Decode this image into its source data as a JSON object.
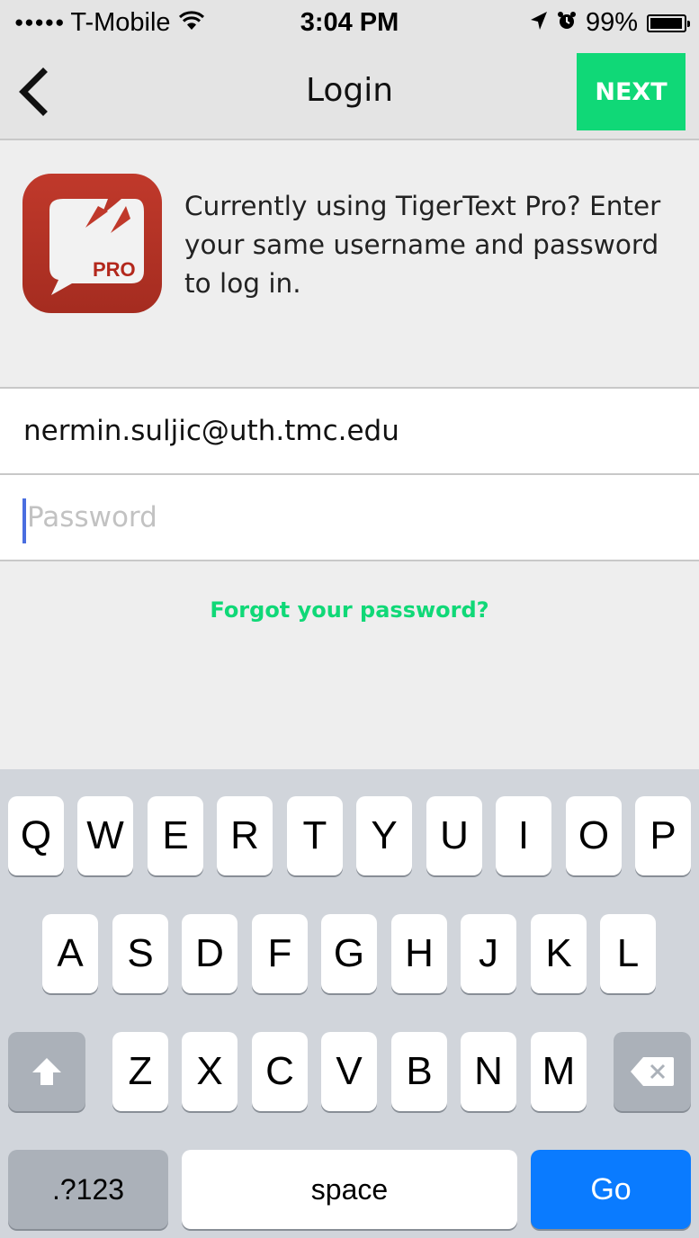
{
  "status_bar": {
    "signal": "●●●●●",
    "carrier": "T-Mobile",
    "wifi_icon": "wifi-icon",
    "time": "3:04 PM",
    "battery": "99%"
  },
  "nav": {
    "title": "Login",
    "next_label": "NEXT",
    "accent_color": "#10d877"
  },
  "info": {
    "app_icon_badge": "PRO",
    "message": "Currently using TigerText Pro? Enter your same username and password to log in."
  },
  "form": {
    "email_value": "nermin.suljic@uth.tmc.edu",
    "password_placeholder": "Password",
    "forgot_label": "Forgot your password?"
  },
  "keyboard": {
    "row1": [
      "Q",
      "W",
      "E",
      "R",
      "T",
      "Y",
      "U",
      "I",
      "O",
      "P"
    ],
    "row2": [
      "A",
      "S",
      "D",
      "F",
      "G",
      "H",
      "J",
      "K",
      "L"
    ],
    "row3": [
      "Z",
      "X",
      "C",
      "V",
      "B",
      "N",
      "M"
    ],
    "numbers_label": ".?123",
    "space_label": "space",
    "go_label": "Go"
  }
}
